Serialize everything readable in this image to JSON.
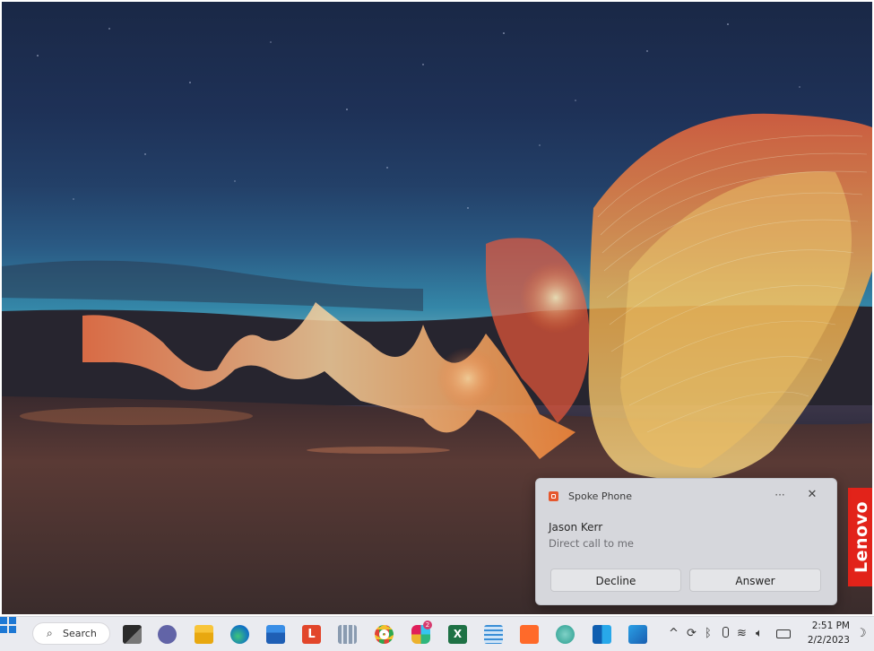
{
  "notification": {
    "app_name": "Spoke Phone",
    "more_label": "···",
    "close_label": "✕",
    "caller": "Jason Kerr",
    "message": "Direct call to me",
    "decline_label": "Decline",
    "answer_label": "Answer"
  },
  "brand": {
    "logo_text": "Lenovo",
    "color": "#e2231a"
  },
  "taskbar": {
    "search_label": "Search",
    "search_icon": "magnifier-icon",
    "apps": [
      "task-view",
      "teams-chat",
      "file-explorer",
      "edge",
      "microsoft-store",
      "lenovo-vantage",
      "calculator",
      "chrome",
      "slack",
      "excel",
      "notepad",
      "sublime",
      "photos",
      "outlook",
      "remote-desktop"
    ],
    "slack_badge": "2",
    "tray": {
      "time": "2:51 PM",
      "date": "2/2/2023",
      "chevron": "^",
      "icons": [
        "chevron-up-icon",
        "sync-icon",
        "bluetooth-icon",
        "microphone-icon",
        "wifi-icon",
        "volume-icon",
        "battery-icon",
        "notifications-moon-icon"
      ]
    }
  },
  "colors": {
    "accent": "#1e78d4",
    "toast_bg": "#d6d7dc",
    "taskbar_bg": "#eaebf0"
  }
}
